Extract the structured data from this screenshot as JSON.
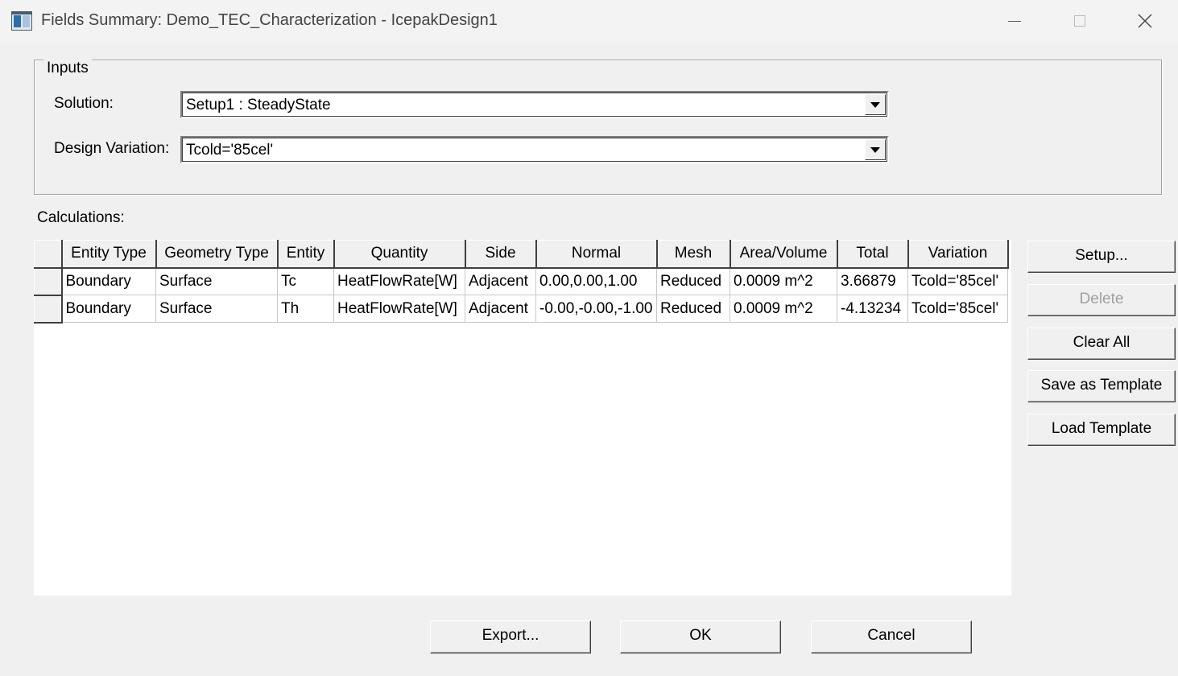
{
  "window": {
    "title": "Fields Summary: Demo_TEC_Characterization - IcepakDesign1"
  },
  "inputs": {
    "group_label": "Inputs",
    "solution_label": "Solution:",
    "solution_value": "Setup1 : SteadyState",
    "design_variation_label": "Design Variation:",
    "design_variation_value": "Tcold='85cel'"
  },
  "calculations": {
    "label": "Calculations:",
    "columns": [
      "Entity Type",
      "Geometry Type",
      "Entity",
      "Quantity",
      "Side",
      "Normal",
      "Mesh",
      "Area/Volume",
      "Total",
      "Variation"
    ],
    "rows": [
      [
        "Boundary",
        "Surface",
        "Tc",
        "HeatFlowRate[W]",
        "Adjacent",
        "0.00,0.00,1.00",
        "Reduced",
        "0.0009 m^2",
        "3.66879",
        "Tcold='85cel'"
      ],
      [
        "Boundary",
        "Surface",
        "Th",
        "HeatFlowRate[W]",
        "Adjacent",
        "-0.00,-0.00,-1.00",
        "Reduced",
        "0.0009 m^2",
        "-4.13234",
        "Tcold='85cel'"
      ]
    ]
  },
  "side_buttons": {
    "setup": "Setup...",
    "delete": "Delete",
    "clear_all": "Clear All",
    "save_template": "Save as Template",
    "load_template": "Load Template"
  },
  "bottom_buttons": {
    "export": "Export...",
    "ok": "OK",
    "cancel": "Cancel"
  }
}
